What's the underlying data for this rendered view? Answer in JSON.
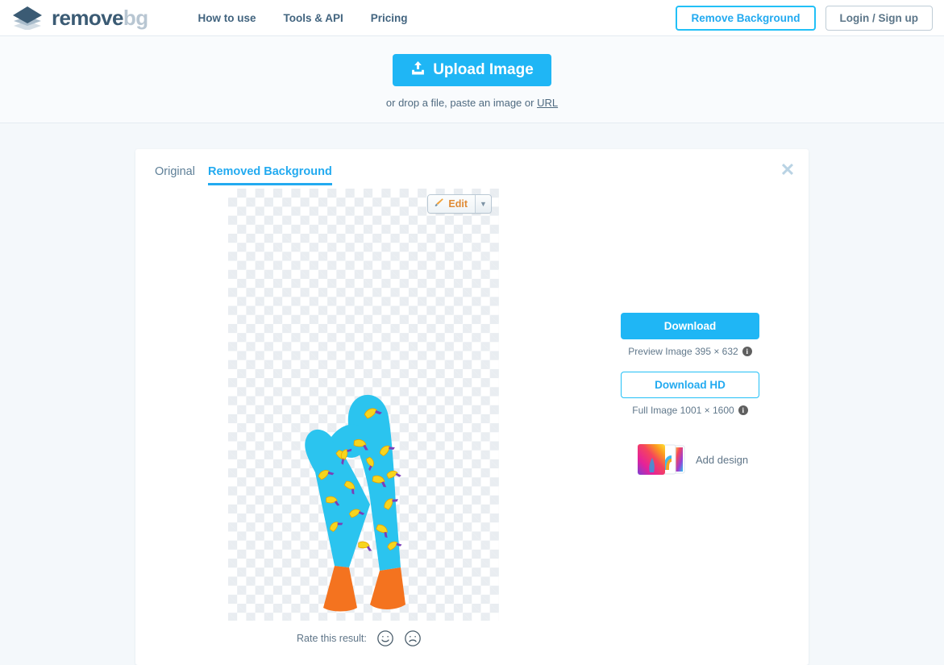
{
  "header": {
    "logo": {
      "icon": "layers-diamond-icon",
      "text_primary": "remove",
      "text_secondary": "bg"
    },
    "nav": [
      {
        "label": "How to use",
        "name": "nav-how-to-use"
      },
      {
        "label": "Tools & API",
        "name": "nav-tools-api"
      },
      {
        "label": "Pricing",
        "name": "nav-pricing"
      }
    ],
    "remove_background_label": "Remove Background",
    "login_label": "Login / Sign up"
  },
  "upload": {
    "button_label": "Upload Image",
    "button_icon": "upload-icon",
    "hint_prefix": "or drop a file, paste an image or ",
    "hint_link": "URL"
  },
  "card": {
    "tabs": [
      {
        "label": "Original",
        "name": "tab-original",
        "active": false
      },
      {
        "label": "Removed Background",
        "name": "tab-removed-background",
        "active": true
      }
    ],
    "close_icon": "close-icon",
    "edit": {
      "label": "Edit",
      "icon": "brush-icon",
      "caret": "chevron-down-icon"
    },
    "canvas": {
      "alt": "banana-pattern-socks-transparent-background"
    }
  },
  "right_panel": {
    "download_label": "Download",
    "preview_note": "Preview Image 395 × 632",
    "download_hd_label": "Download HD",
    "full_note": "Full Image 1001 × 1600",
    "info_glyph": "i",
    "add_design_label": "Add design"
  },
  "rate": {
    "text": "Rate this result:",
    "happy_icon": "smiley-face-icon",
    "sad_icon": "frowny-face-icon"
  },
  "colors": {
    "accent_blue": "#1fb6f5",
    "accent_blue_border": "#22c0f7",
    "nav_text": "#42647f",
    "logo_dark": "#3b5b74",
    "logo_light": "#b8c6d2",
    "page_bg": "#f4f8fb",
    "sock_cyan": "#2bc4ef",
    "sock_orange": "#f4731f",
    "banana_yellow": "#f7d51d"
  }
}
